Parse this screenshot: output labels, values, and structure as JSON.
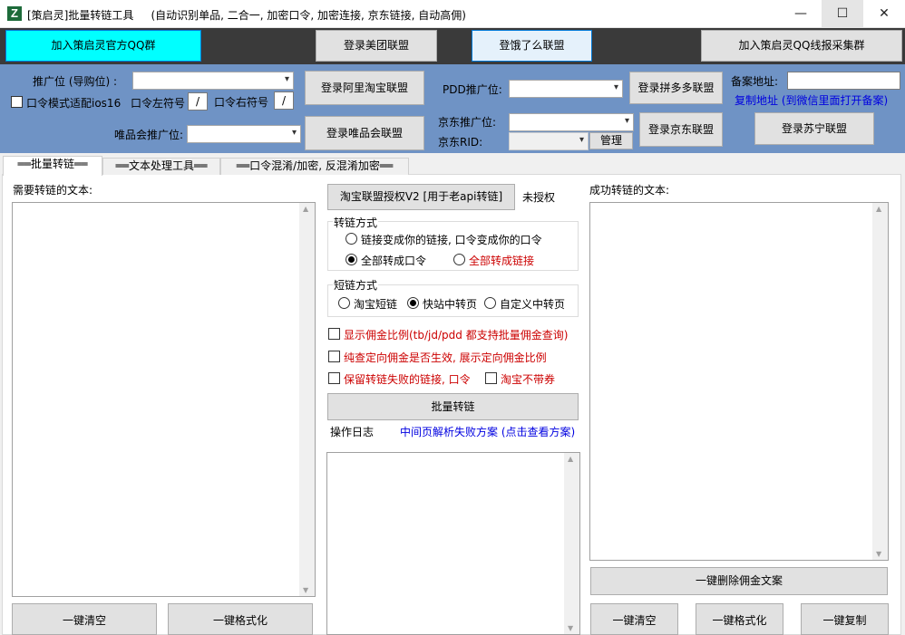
{
  "window": {
    "title": "[策启灵]批量转链工具",
    "subtitle": "(自动识别单品, 二合一, 加密口令, 加密连接, 京东链接, 自动高佣)",
    "min_glyph": "—",
    "max_glyph": "☐",
    "close_glyph": "✕",
    "app_icon_glyph": "Z"
  },
  "topbar": {
    "join_qq_group": "加入策启灵官方QQ群",
    "login_meituan": "登录美团联盟",
    "login_eleme": "登饿了么联盟",
    "join_qq_collect": "加入策启灵QQ线报采集群"
  },
  "config": {
    "promo_label": "推广位 (导购位) :",
    "ios16_label": "口令模式适配ios16",
    "left_symbol_label": "口令左符号",
    "left_symbol_value": "/",
    "right_symbol_label": "口令右符号",
    "right_symbol_value": "/",
    "vip_promo_label": "唯品会推广位:",
    "login_alimama": "登录阿里淘宝联盟",
    "login_vip": "登录唯品会联盟",
    "pdd_label": "PDD推广位:",
    "login_pdd": "登录拼多多联盟",
    "jd_promo_label": "京东推广位:",
    "jd_rid_label": "京东RID:",
    "manage_label": "管理",
    "login_jd": "登录京东联盟",
    "beian_label": "备案地址:",
    "beian_value": "",
    "copy_addr_link": "复制地址 (到微信里面打开备案)",
    "login_suning": "登录苏宁联盟"
  },
  "tabs": [
    {
      "label": "══批量转链══"
    },
    {
      "label": "══文本处理工具══"
    },
    {
      "label": "══口令混淆/加密, 反混淆加密══"
    }
  ],
  "left": {
    "label": "需要转链的文本:",
    "clear_btn": "一键清空",
    "format_btn": "一键格式化"
  },
  "middle": {
    "auth_btn": "淘宝联盟授权V2  [用于老api转链]",
    "auth_status": "未授权",
    "convert_mode_title": "转链方式",
    "opt_link_to_yours": "链接变成你的链接, 口令变成你的口令",
    "opt_all_to_token": "全部转成口令",
    "opt_all_to_link": "全部转成链接",
    "short_mode_title": "短链方式",
    "opt_taobao_short": "淘宝短链",
    "opt_kuaizhan": "快站中转页",
    "opt_custom": "自定义中转页",
    "chk_show_commission": "显示佣金比例(tb/jd/pdd 都支持批量佣金查询)",
    "chk_pure_check": "纯查定向佣金是否生效, 展示定向佣金比例",
    "chk_keep_failed": "保留转链失败的链接, 口令",
    "chk_no_coupon": "淘宝不带券",
    "batch_convert_btn": "批量转链",
    "log_label": "操作日志",
    "fail_solution_link": "中间页解析失败方案 (点击查看方案)"
  },
  "right": {
    "label": "成功转链的文本:",
    "delete_commission_btn": "一键删除佣金文案",
    "clear_btn": "一键清空",
    "format_btn": "一键格式化",
    "copy_btn": "一键复制"
  },
  "icons": {
    "dropdown": "▾",
    "scroll_up": "▲",
    "scroll_down": "▼"
  },
  "colors": {
    "config_bg": "#6f93c5",
    "cyan_button": "#00ffff",
    "eleme_button": "#e5f1fb",
    "red_text": "#cc0000",
    "blue_link": "#0000e0"
  }
}
